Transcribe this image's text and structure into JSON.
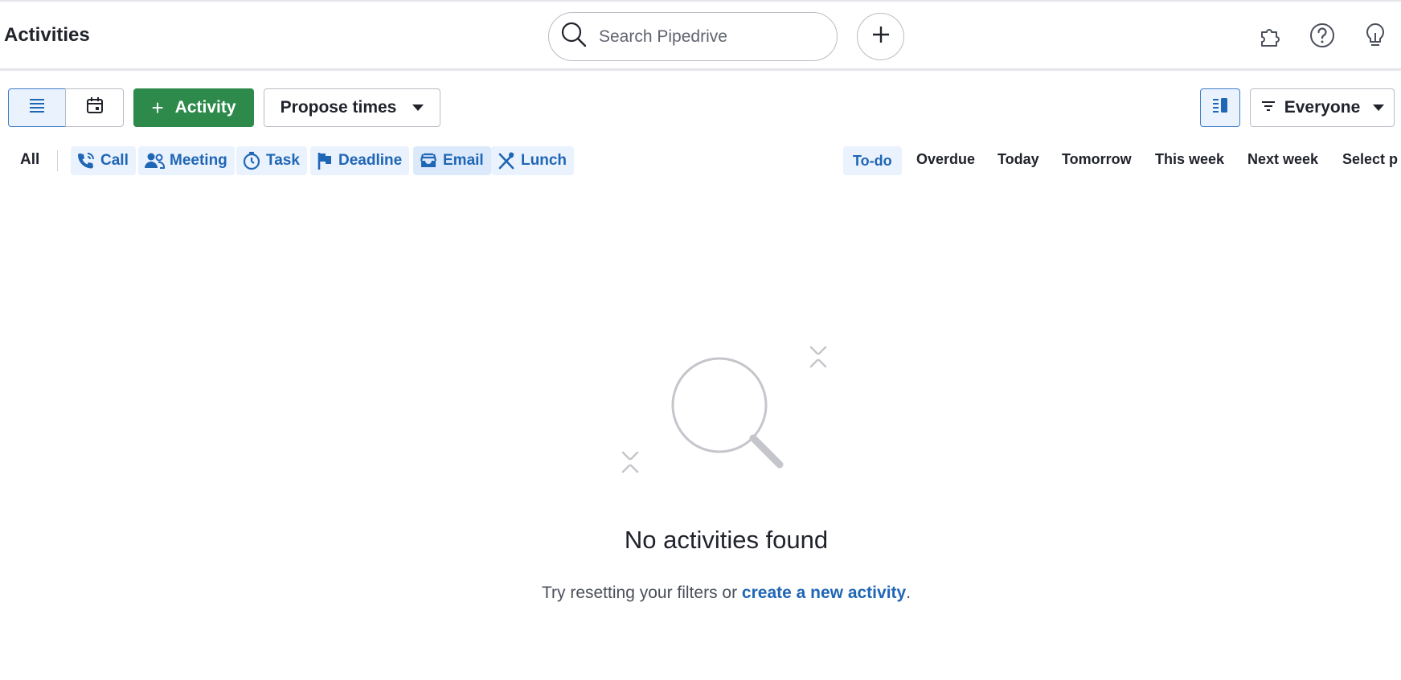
{
  "header": {
    "title": "Activities",
    "search_placeholder": "Search Pipedrive"
  },
  "toolbar": {
    "add_activity_label": "Activity",
    "add_activity_plus": "+",
    "propose_times_label": "Propose times",
    "owner_filter_label": "Everyone"
  },
  "type_filters": {
    "all_label": "All",
    "items": [
      {
        "label": "Call",
        "icon": "phone-icon"
      },
      {
        "label": "Meeting",
        "icon": "people-icon"
      },
      {
        "label": "Task",
        "icon": "clock-icon"
      },
      {
        "label": "Deadline",
        "icon": "flag-icon"
      },
      {
        "label": "Email",
        "icon": "inbox-icon"
      },
      {
        "label": "Lunch",
        "icon": "utensils-icon"
      }
    ]
  },
  "date_filters": [
    "To-do",
    "Overdue",
    "Today",
    "Tomorrow",
    "This week",
    "Next week",
    "Select p"
  ],
  "empty_state": {
    "title": "No activities found",
    "text_before": "Try resetting your filters or ",
    "link_text": "create a new activity",
    "text_after": "."
  },
  "colors": {
    "accent_blue": "#1f66b5",
    "chip_bg": "#eaf2fd",
    "primary_green": "#2d8a4b"
  }
}
